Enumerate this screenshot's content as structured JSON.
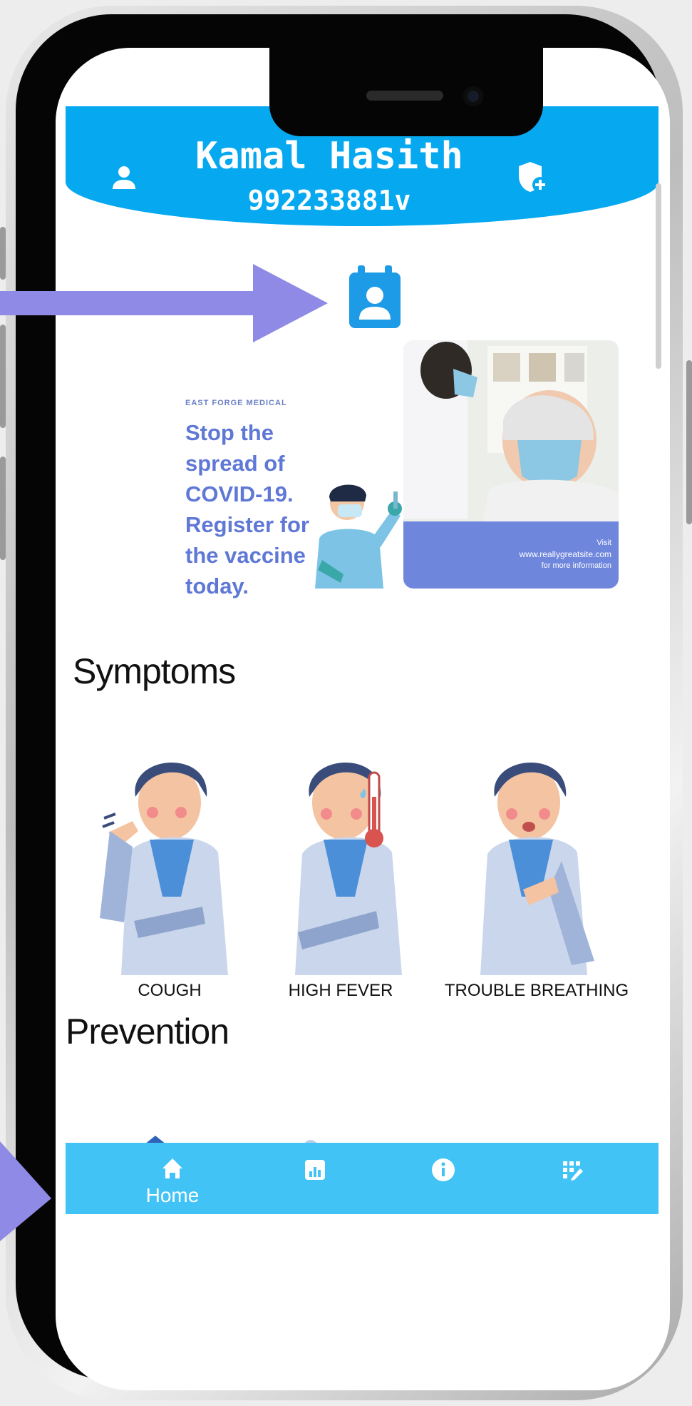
{
  "header": {
    "user_name": "Kamal Hasith",
    "user_id": "992233881v"
  },
  "banner": {
    "organization": "EAST FORGE MEDICAL",
    "message": "Stop the spread of COVID-19. Register for the vaccine today.",
    "visit_line": "Visit",
    "website": "www.reallygreatsite.com",
    "more_info": "for more information"
  },
  "sections": {
    "symptoms_title": "Symptoms",
    "prevention_title": "Prevention"
  },
  "symptoms": [
    {
      "label": "COUGH",
      "icon": "cough-icon"
    },
    {
      "label": "HIGH FEVER",
      "icon": "fever-icon"
    },
    {
      "label": "TROUBLE BREATHING",
      "icon": "breathing-icon"
    }
  ],
  "bottom_nav": {
    "home_label": "Home",
    "items": [
      "home-icon",
      "stats-icon",
      "info-icon",
      "checklist-icon"
    ]
  },
  "colors": {
    "header_blue": "#06a8ef",
    "nav_blue": "#41c3f6",
    "banner_blue": "#6f86dd",
    "annotation_arrow": "#8e8ae6"
  }
}
